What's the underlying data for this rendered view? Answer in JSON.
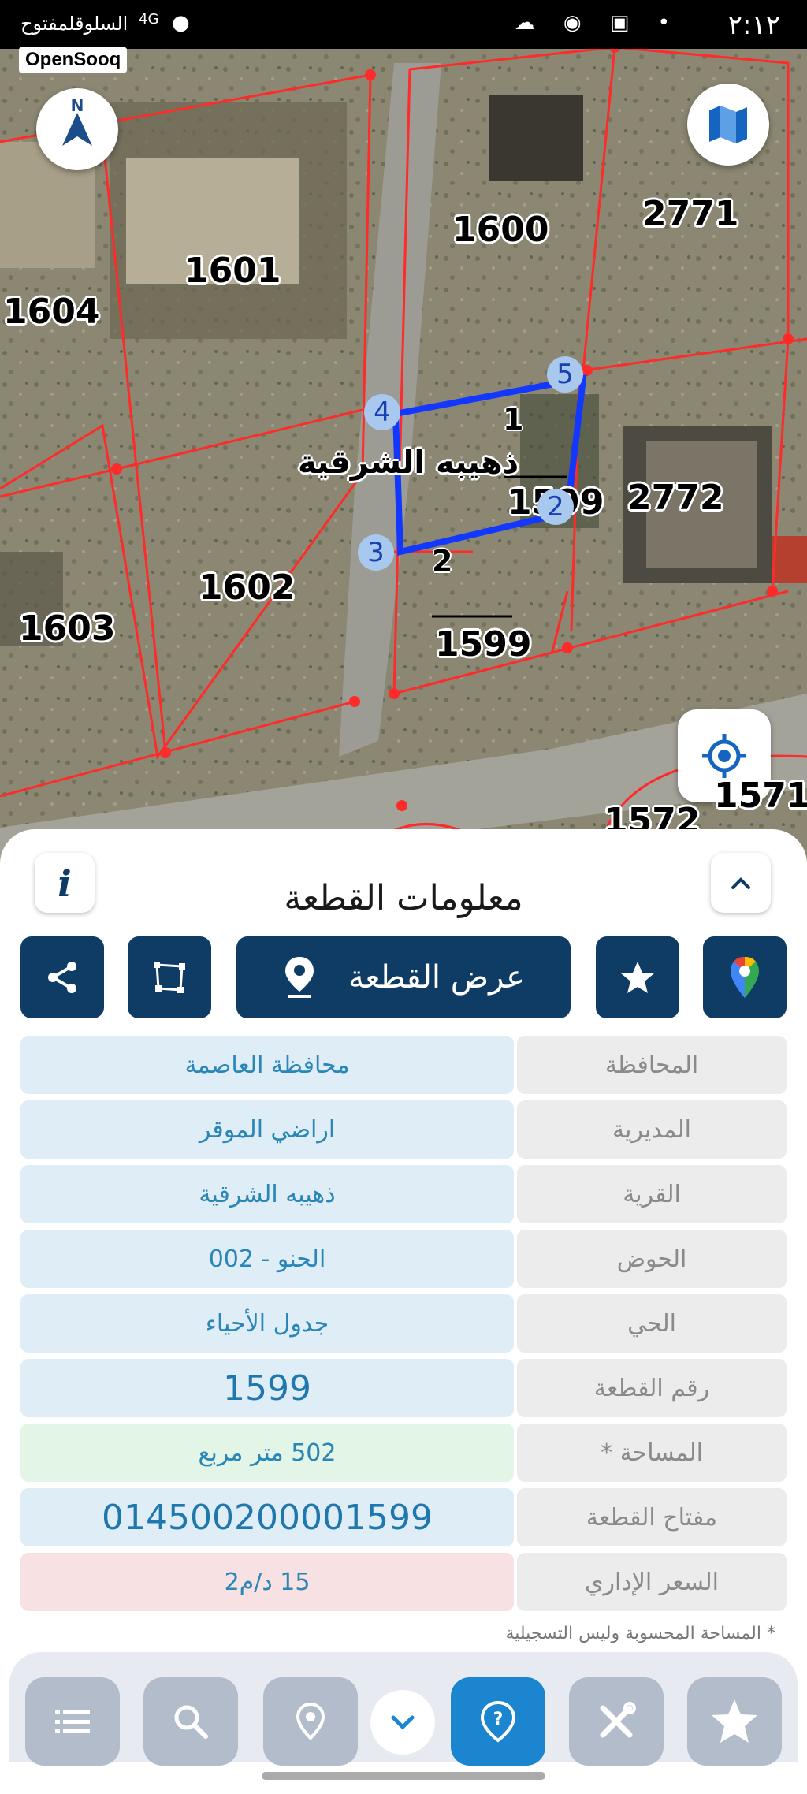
{
  "status_bar": {
    "time": "٢:١٢",
    "carrier": "السلوقلمفتوح",
    "network": "4G",
    "app_badge": "OpenSooq"
  },
  "map": {
    "compass_letter": "N",
    "plot_numbers": [
      "1600",
      "2771",
      "1601",
      "1604",
      "2772",
      "1602",
      "1603",
      "1599",
      "1599",
      "1572",
      "1571"
    ],
    "vertex_labels": [
      "5",
      "4",
      "2",
      "3"
    ],
    "edge_labels": [
      "1",
      "2"
    ],
    "village_label": "ذهيبه الشرقية",
    "colors": {
      "parcel_lines": "#ff2a2a",
      "selected_parcel": "#1238ff"
    }
  },
  "panel": {
    "title": "معلومات القطعة",
    "show_parcel_label": "عرض القطعة",
    "rows": [
      {
        "label": "المحافظة",
        "value": "محافظة العاصمة"
      },
      {
        "label": "المديرية",
        "value": "اراضي الموقر"
      },
      {
        "label": "القرية",
        "value": "ذهيبه الشرقية"
      },
      {
        "label": "الحوض",
        "value": "الحنو - 002"
      },
      {
        "label": "الحي",
        "value": "جدول الأحياء"
      },
      {
        "label": "رقم القطعة",
        "value": "1599"
      },
      {
        "label": "المساحة *",
        "value": "502   متر مربع"
      },
      {
        "label": "مفتاح القطعة",
        "value": "014500200001599"
      },
      {
        "label": "السعر الإداري",
        "value": "15 د/م2"
      }
    ],
    "footnote": "* المساحة المحسوبة وليس التسجيلية"
  },
  "icons": {
    "info": "info-icon",
    "collapse": "chevron-up-icon",
    "share": "share-icon",
    "polygon": "polygon-icon",
    "pin": "location-pin-icon",
    "star": "star-icon",
    "google_maps": "google-maps-icon",
    "locate": "gps-locate-icon",
    "map_layers": "map-icon"
  }
}
